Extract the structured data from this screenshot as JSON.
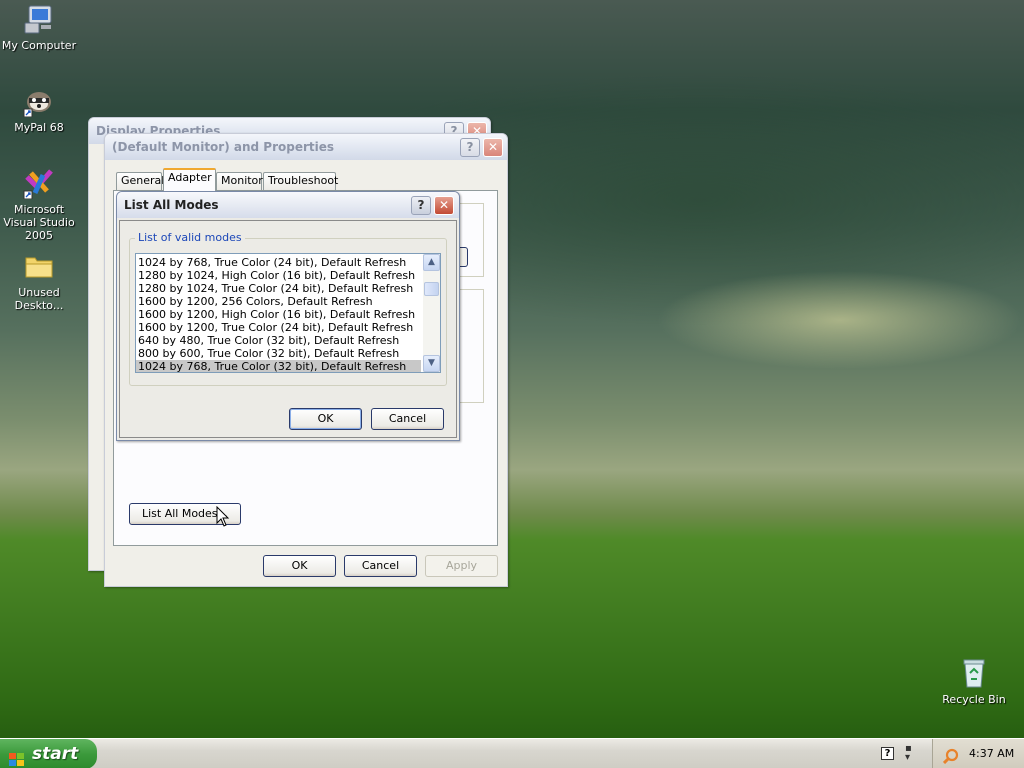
{
  "desktop": {
    "icons": [
      {
        "label": "My Computer",
        "icon": "computer-icon"
      },
      {
        "label": "MyPal 68",
        "icon": "raccoon-app-icon"
      },
      {
        "label": "Microsoft Visual Studio 2005",
        "icon": "visual-studio-icon"
      },
      {
        "label": "Unused Deskto...",
        "icon": "folder-icon"
      },
      {
        "label": "Recycle Bin",
        "icon": "recycle-bin-icon"
      }
    ]
  },
  "display_properties_window": {
    "title": "Display Properties"
  },
  "monitor_properties_window": {
    "title": "(Default Monitor) and  Properties",
    "tabs": [
      "General",
      "Adapter",
      "Monitor",
      "Troubleshoot"
    ],
    "selected_tab": "Adapter",
    "list_all_modes_button": "List All Modes...",
    "ok_button": "OK",
    "cancel_button": "Cancel",
    "apply_button": "Apply"
  },
  "list_all_modes_dialog": {
    "title": "List All Modes",
    "group_label": "List of valid modes",
    "modes": [
      "1024 by 768, True Color (24 bit), Default Refresh",
      "1280 by 1024, High Color (16 bit), Default Refresh",
      "1280 by 1024, True Color (24 bit), Default Refresh",
      "1600 by 1200, 256 Colors, Default Refresh",
      "1600 by 1200, High Color (16 bit), Default Refresh",
      "1600 by 1200, True Color (24 bit), Default Refresh",
      "640 by 480, True Color (32 bit), Default Refresh",
      "800 by 600, True Color (32 bit), Default Refresh",
      "1024 by 768, True Color (32 bit), Default Refresh"
    ],
    "selected_mode": "1024 by 768, True Color (32 bit), Default Refresh",
    "ok_button": "OK",
    "cancel_button": "Cancel"
  },
  "taskbar": {
    "start_label": "start",
    "clock": "4:37 AM"
  },
  "colors": {
    "title_active": "#222222",
    "title_inactive": "#8d95a8",
    "selection": "#c8c8c8",
    "group_label": "#1c47b8"
  }
}
